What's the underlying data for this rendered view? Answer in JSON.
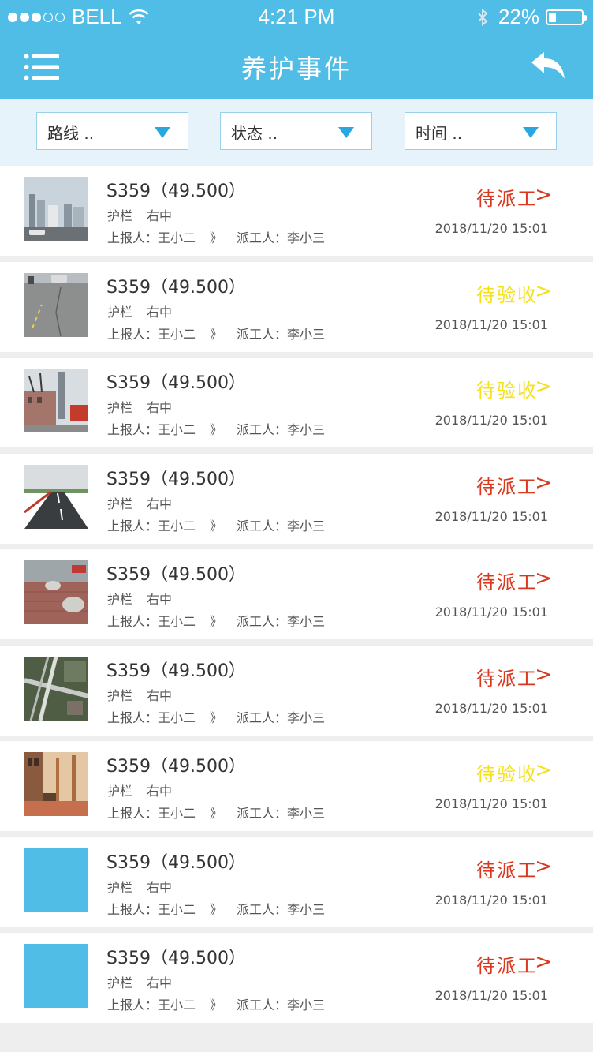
{
  "status_bar": {
    "carrier": "BELL",
    "time": "4:21 PM",
    "battery": "22%",
    "battery_level": 0.22
  },
  "header": {
    "title": "养护事件",
    "menu_icon": "menu-icon",
    "back_icon": "back-arrow-icon"
  },
  "filters": {
    "route_label": "路线 ..",
    "status_label": "状态 ..",
    "time_label": "时间 .."
  },
  "colors": {
    "primary": "#4fbde6",
    "pending_dispatch": "#d9381e",
    "pending_acceptance": "#f5e11a"
  },
  "events": [
    {
      "code": "S359（49.500）",
      "type": "护栏",
      "position": "右中",
      "reporter": "上报人：王小二",
      "arrow": "》",
      "dispatcher": "派工人：李小三",
      "status": "待派工",
      "status_kind": "dispatch",
      "time": "2018/11/20  15:01",
      "thumb": "city-skyline-photo"
    },
    {
      "code": "S359（49.500）",
      "type": "护栏",
      "position": "右中",
      "reporter": "上报人：王小二",
      "arrow": "》",
      "dispatcher": "派工人：李小三",
      "status": "待验收",
      "status_kind": "accept",
      "time": "2018/11/20  15:01",
      "thumb": "cracked-road-photo"
    },
    {
      "code": "S359（49.500）",
      "type": "护栏",
      "position": "右中",
      "reporter": "上报人：王小二",
      "arrow": "》",
      "dispatcher": "派工人：李小三",
      "status": "待验收",
      "status_kind": "accept",
      "time": "2018/11/20  15:01",
      "thumb": "street-buildings-photo"
    },
    {
      "code": "S359（49.500）",
      "type": "护栏",
      "position": "右中",
      "reporter": "上报人：王小二",
      "arrow": "》",
      "dispatcher": "派工人：李小三",
      "status": "待派工",
      "status_kind": "dispatch",
      "time": "2018/11/20  15:01",
      "thumb": "highway-photo"
    },
    {
      "code": "S359（49.500）",
      "type": "护栏",
      "position": "右中",
      "reporter": "上报人：王小二",
      "arrow": "》",
      "dispatcher": "派工人：李小三",
      "status": "待派工",
      "status_kind": "dispatch",
      "time": "2018/11/20  15:01",
      "thumb": "brick-pavement-photo"
    },
    {
      "code": "S359（49.500）",
      "type": "护栏",
      "position": "右中",
      "reporter": "上报人：王小二",
      "arrow": "》",
      "dispatcher": "派工人：李小三",
      "status": "待派工",
      "status_kind": "dispatch",
      "time": "2018/11/20  15:01",
      "thumb": "aerial-interchange-photo"
    },
    {
      "code": "S359（49.500）",
      "type": "护栏",
      "position": "右中",
      "reporter": "上报人：王小二",
      "arrow": "》",
      "dispatcher": "派工人：李小三",
      "status": "待验收",
      "status_kind": "accept",
      "time": "2018/11/20  15:01",
      "thumb": "street-trees-photo"
    },
    {
      "code": "S359（49.500）",
      "type": "护栏",
      "position": "右中",
      "reporter": "上报人：王小二",
      "arrow": "》",
      "dispatcher": "派工人：李小三",
      "status": "待派工",
      "status_kind": "dispatch",
      "time": "2018/11/20  15:01",
      "thumb": "placeholder-image"
    },
    {
      "code": "S359（49.500）",
      "type": "护栏",
      "position": "右中",
      "reporter": "上报人：王小二",
      "arrow": "》",
      "dispatcher": "派工人：李小三",
      "status": "待派工",
      "status_kind": "dispatch",
      "time": "2018/11/20  15:01",
      "thumb": "placeholder-image"
    }
  ]
}
